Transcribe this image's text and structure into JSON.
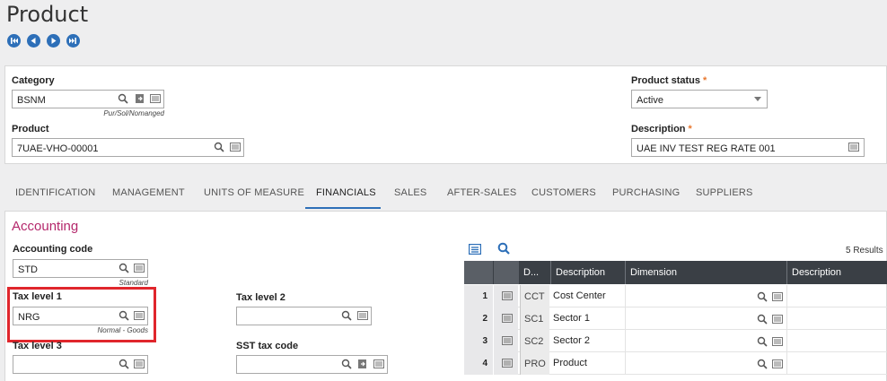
{
  "page": {
    "title": "Product"
  },
  "nav": [
    "first-record",
    "previous-record",
    "next-record",
    "last-record"
  ],
  "header": {
    "category": {
      "label": "Category",
      "value": "BSNM",
      "hint": "Pur/Sol/Nomanged"
    },
    "product": {
      "label": "Product",
      "value": "7UAE-VHO-00001"
    },
    "product_status": {
      "label": "Product status",
      "value": "Active",
      "required": "*"
    },
    "description": {
      "label": "Description",
      "value": "UAE INV TEST REG RATE 001",
      "required": "*"
    }
  },
  "tabs": [
    "IDENTIFICATION",
    "MANAGEMENT",
    "UNITS OF MEASURE",
    "FINANCIALS",
    "SALES",
    "AFTER-SALES",
    "CUSTOMERS",
    "PURCHASING",
    "SUPPLIERS"
  ],
  "active_tab": "FINANCIALS",
  "accounting": {
    "title": "Accounting",
    "accounting_code": {
      "label": "Accounting code",
      "value": "STD",
      "hint": "Standard"
    },
    "tax_level_1": {
      "label": "Tax level 1",
      "value": "NRG",
      "hint": "Normal - Goods"
    },
    "tax_level_2": {
      "label": "Tax level 2",
      "value": ""
    },
    "tax_level_3": {
      "label": "Tax level 3",
      "value": ""
    },
    "sst_tax_code": {
      "label": "SST tax code",
      "value": ""
    }
  },
  "grid": {
    "results": "5 Results",
    "columns": [
      "D...",
      "Description",
      "Dimension",
      "Description"
    ],
    "rows": [
      {
        "num": "1",
        "code": "CCT",
        "description": "Cost Center",
        "dimension": "",
        "dim_description": ""
      },
      {
        "num": "2",
        "code": "SC1",
        "description": "Sector 1",
        "dimension": "",
        "dim_description": ""
      },
      {
        "num": "3",
        "code": "SC2",
        "description": "Sector 2",
        "dimension": "",
        "dim_description": ""
      },
      {
        "num": "4",
        "code": "PRO",
        "description": "Product",
        "dimension": "",
        "dim_description": ""
      }
    ]
  },
  "colors": {
    "accent": "#2d6fb8",
    "section": "#b4276b",
    "required": "#e8762d",
    "highlight": "#e0262c",
    "grid_header": "#3a3f45"
  }
}
